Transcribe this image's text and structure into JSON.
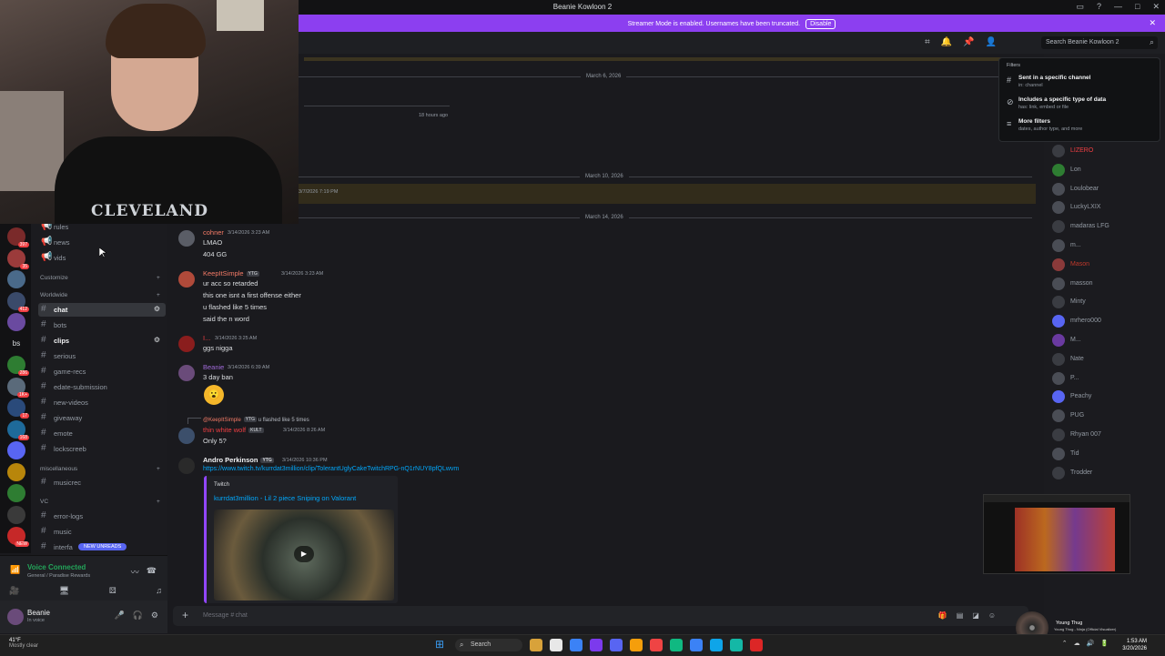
{
  "window": {
    "title": "Beanie Kowloon 2"
  },
  "banner": {
    "text": "Streamer Mode is enabled. Usernames have been truncated.",
    "button": "Disable"
  },
  "header": {
    "search_placeholder": "Search Beanie Kowloon 2"
  },
  "filters": {
    "heading": "Filters",
    "items": [
      {
        "title": "Sent in a specific channel",
        "sub": "in: channel",
        "icon": "hash-icon"
      },
      {
        "title": "Includes a specific type of data",
        "sub": "has: link, embed or file",
        "icon": "link-icon"
      },
      {
        "title": "More filters",
        "sub": "dates, author type, and more",
        "icon": "sliders-icon"
      }
    ]
  },
  "server_badges": [
    "397",
    "35",
    "",
    "412",
    "",
    "bs",
    "286",
    "1K+",
    "17",
    "168",
    "",
    "",
    "",
    "",
    "NEW"
  ],
  "sidebar": {
    "channels_top": [
      {
        "name": "rules",
        "icon": "megaphone-icon"
      },
      {
        "name": "news",
        "icon": "megaphone-icon"
      },
      {
        "name": "vids",
        "icon": "megaphone-icon"
      }
    ],
    "cat_customize": "Customize",
    "cat_worldwide": "Worldwide",
    "channels": [
      {
        "name": "chat",
        "bold": true,
        "selected": true
      },
      {
        "name": "bots",
        "bold": false
      },
      {
        "name": "clips",
        "bold": true
      },
      {
        "name": "serious",
        "bold": false
      },
      {
        "name": "game-recs",
        "bold": false
      },
      {
        "name": "edate-submission",
        "bold": false
      },
      {
        "name": "new-videos",
        "bold": false
      },
      {
        "name": "giveaway",
        "bold": false
      },
      {
        "name": "emote",
        "bold": false
      },
      {
        "name": "lockscreeb",
        "bold": false
      }
    ],
    "cat_misc": "miscellaneous",
    "misc_channels": [
      {
        "name": "musicrec"
      }
    ],
    "cat_vc": "VC",
    "vc_channels": [
      {
        "name": "error-logs"
      },
      {
        "name": "music"
      },
      {
        "name": "interfa"
      }
    ],
    "new_unreads": "NEW UNREADS"
  },
  "voice": {
    "status": "Voice Connected",
    "location": "General / Paradise Rewards"
  },
  "user": {
    "name": "Beanie",
    "status": "In voice"
  },
  "chat": {
    "dates": [
      "March 6, 2026",
      "March 10, 2026",
      "March 14, 2026"
    ],
    "ghost_time": "18 hours ago",
    "ghost_ts": "3/7/2026 7:19 PM",
    "messages": [
      {
        "user": "cohner",
        "color": "#f47b67",
        "time": "3/14/2026 3:23 AM",
        "tag": "",
        "lines": [
          "LMAO",
          "404 GG"
        ]
      },
      {
        "user": "KeepItSimple",
        "color": "#f47b67",
        "time": "3/14/2026 3:23 AM",
        "tag": "YTG",
        "lines": [
          "ur acc so retarded",
          "this one isnt a first offense either",
          "u flashed like 5 times",
          "said the n word"
        ]
      },
      {
        "user": "I...",
        "color": "#f23f43",
        "time": "3/14/2026 3:25 AM",
        "tag": "",
        "lines": [
          "ggs nigga"
        ]
      },
      {
        "user": "Beanie",
        "color": "#a06ad8",
        "time": "3/14/2026 6:39 AM",
        "tag": "",
        "lines": [
          "3 day ban"
        ]
      },
      {
        "user": "thin white wolf",
        "color": "#f23f43",
        "time": "3/14/2026 8:26 AM",
        "tag": "KULT",
        "reply_user": "@KeepItSimple",
        "reply_tag": "YTG",
        "reply_text": "u flashed like 5 times",
        "lines": [
          "Only 5?"
        ]
      },
      {
        "user": "Andro Perkinson",
        "color": "#f2f3f5",
        "time": "3/14/2026 10:36 PM",
        "tag": "YTG",
        "lines": []
      }
    ],
    "link": "https://www.twitch.tv/kurrdat3million/clip/TolerantUglyCakeTwitchRPG-nQ1rNUY8pfQLwvm",
    "embed": {
      "provider": "Twitch",
      "title": "kurrdat3million - Lil 2 piece Sniping on Valorant"
    },
    "composer_placeholder": "Message # chat"
  },
  "members": [
    {
      "name": "LIZERO",
      "color": "#f23f43"
    },
    {
      "name": "Lon",
      "color": "#949ba4"
    },
    {
      "name": "Loulobear",
      "color": "#949ba4"
    },
    {
      "name": "LuckyLXIX",
      "color": "#949ba4"
    },
    {
      "name": "madaras LFG",
      "color": "#949ba4"
    },
    {
      "name": "m...",
      "color": "#949ba4"
    },
    {
      "name": "Mason",
      "color": "#c0392b"
    },
    {
      "name": "masson",
      "color": "#949ba4"
    },
    {
      "name": "Minty",
      "color": "#949ba4"
    },
    {
      "name": "mrhero000",
      "color": "#949ba4"
    },
    {
      "name": "M...",
      "color": "#949ba4"
    },
    {
      "name": "Nate",
      "color": "#949ba4"
    },
    {
      "name": "P...",
      "color": "#949ba4"
    },
    {
      "name": "Peachy",
      "color": "#949ba4"
    },
    {
      "name": "PUG",
      "color": "#949ba4"
    },
    {
      "name": "Rhyan 007",
      "color": "#949ba4"
    },
    {
      "name": "Tid",
      "color": "#949ba4"
    },
    {
      "name": "Trodder",
      "color": "#949ba4"
    }
  ],
  "nowplaying": {
    "song": "Young Thug",
    "artist": "Young Thug - Ninja (Official Visualizer)"
  },
  "taskbar": {
    "temp": "41°F",
    "weather": "Mostly clear",
    "search": "Search",
    "time": "1:53 AM",
    "date": "3/20/2026"
  },
  "colors": {
    "accent": "#5865f2",
    "banner": "#8c3ff0",
    "online": "#23a55a",
    "danger": "#f23f43",
    "link": "#00a8fc"
  }
}
